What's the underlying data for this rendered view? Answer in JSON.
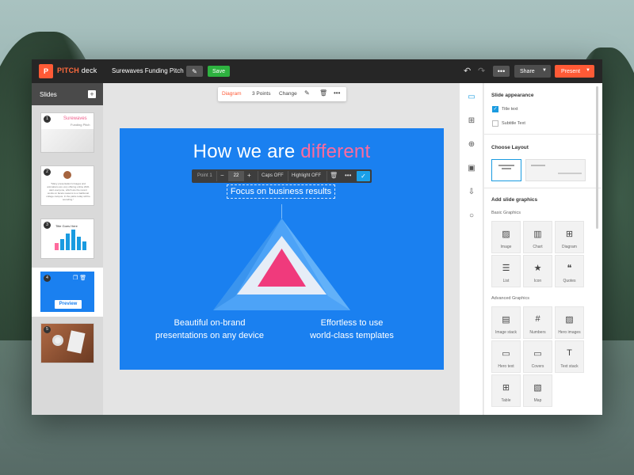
{
  "app": {
    "logo_mark": "P",
    "logo_brand": "PITCH",
    "logo_product": " deck",
    "doc_title": "Surewaves Funding Pitch",
    "edit_icon": "pencil-icon",
    "save_label": "Save",
    "more_label": "•••",
    "share_label": "Share",
    "present_label": "Present",
    "accent_color": "#ff5a36"
  },
  "slides_panel": {
    "title": "Slides",
    "add_label": "+",
    "thumbs": [
      {
        "num": "1",
        "title": "Surewaves",
        "subtitle": "Funding Pitch"
      },
      {
        "num": "2",
        "text": "\"Many presentation's linages and animations are very offering online 2021 alert everyone, which are the recent works on facets reasons to a traditional college campus. In the parks today will be sounding.\""
      },
      {
        "num": "3",
        "title": "Title Goes Here"
      },
      {
        "num": "4",
        "preview_label": "Preview"
      },
      {
        "num": "5"
      }
    ]
  },
  "slide_toolbar": {
    "diagram": "Diagram",
    "points": "3 Points",
    "change": "Change"
  },
  "slide": {
    "title_plain": "How we are ",
    "title_highlight": "different",
    "background_color": "#1a80f0",
    "highlight_color": "#ff6b9d",
    "point_toolbar": {
      "label": "Point 1",
      "minus": "−",
      "size": "22",
      "plus": "+",
      "caps": "Caps OFF",
      "highlight": "Highlight OFF",
      "more": "•••",
      "confirm": "✓"
    },
    "point_top": "Focus on business results",
    "point_left_1": "Beautiful on-brand",
    "point_left_2": "presentations on any device",
    "point_right_1": "Effortless to use",
    "point_right_2": "world-class templates"
  },
  "right_panel": {
    "appearance_heading": "Slide appearance",
    "title_text": "Title text",
    "subtitle_text": "Subtitle Text",
    "title_checked": true,
    "subtitle_checked": false,
    "layout_heading": "Choose Layout",
    "graphics_heading": "Add slide graphics",
    "basic_heading": "Basic Graphics",
    "basic": [
      {
        "label": "Image",
        "icon": "image-icon"
      },
      {
        "label": "Chart",
        "icon": "chart-icon"
      },
      {
        "label": "Diagram",
        "icon": "diagram-icon"
      },
      {
        "label": "List",
        "icon": "list-icon"
      },
      {
        "label": "Icon",
        "icon": "star-icon"
      },
      {
        "label": "Quotes",
        "icon": "quotes-icon"
      }
    ],
    "advanced_heading": "Advanced Graphics",
    "advanced": [
      {
        "label": "Image stack",
        "icon": "image-stack-icon"
      },
      {
        "label": "Numbers",
        "icon": "numbers-icon"
      },
      {
        "label": "Hero images",
        "icon": "hero-images-icon"
      },
      {
        "label": "Hero text",
        "icon": "hero-text-icon"
      },
      {
        "label": "Covers",
        "icon": "covers-icon"
      },
      {
        "label": "Text stack",
        "icon": "text-stack-icon"
      },
      {
        "label": "Table",
        "icon": "table-icon"
      },
      {
        "label": "Map",
        "icon": "map-icon"
      }
    ]
  }
}
